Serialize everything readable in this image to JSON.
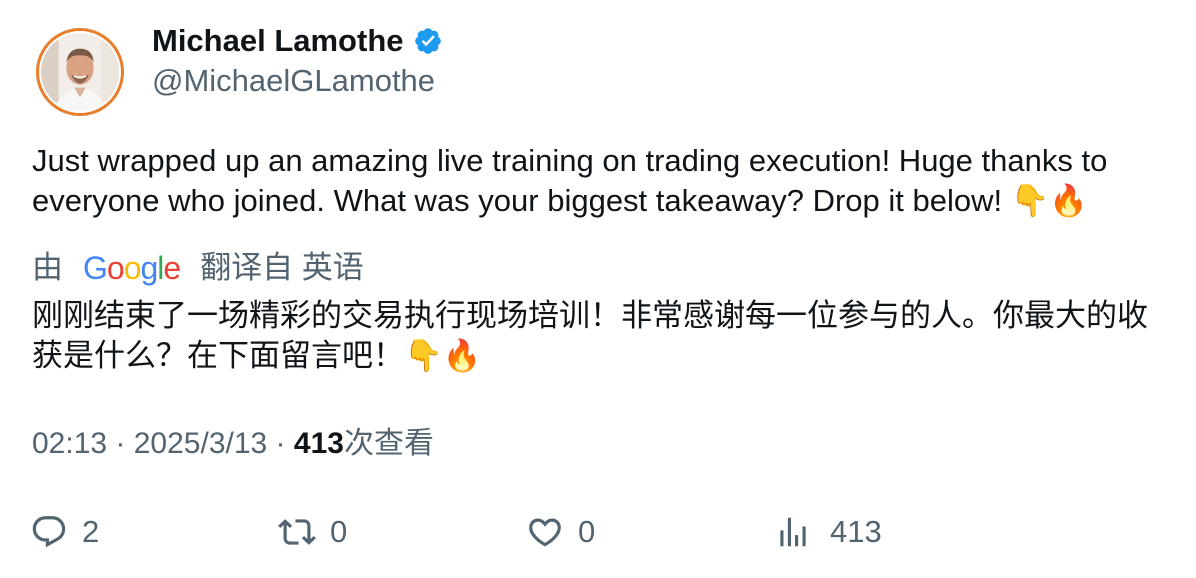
{
  "author": {
    "name": "Michael Lamothe",
    "handle": "@MichaelGLamothe",
    "verified": true,
    "avatar_ring_color": "#e87d2b",
    "verified_color": "#1d9bf0"
  },
  "tweet": {
    "text": "Just wrapped up an amazing live training on trading execution! Huge thanks to everyone who joined. What was your biggest takeaway? Drop it below! 👇🔥"
  },
  "translation": {
    "prefix": "由",
    "provider": "Google",
    "suffix": "翻译自 英语",
    "text": "刚刚结束了一场精彩的交易执行现场培训！非常感谢每一位参与的人。你最大的收获是什么？在下面留言吧！👇🔥"
  },
  "meta": {
    "time": "02:13",
    "separator": " · ",
    "date": "2025/3/13",
    "views_count": "413",
    "views_label": "次查看"
  },
  "actions": {
    "replies": "2",
    "reposts": "0",
    "likes": "0",
    "views": "413"
  },
  "icons": {
    "reply": "reply-bubble-icon",
    "repost": "repost-arrows-icon",
    "like": "heart-icon",
    "views": "bar-chart-icon",
    "verified": "verified-badge-icon"
  }
}
